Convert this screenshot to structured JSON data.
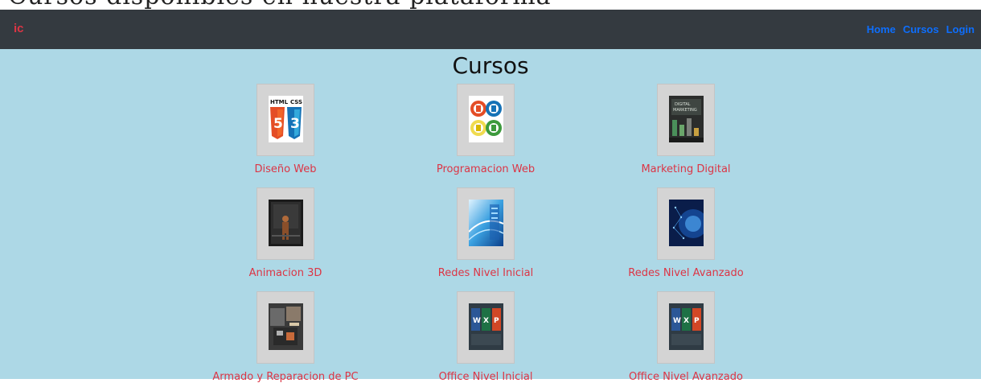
{
  "navbar": {
    "brand": "ic",
    "links": [
      {
        "label": "Home"
      },
      {
        "label": "Cursos"
      },
      {
        "label": "Login"
      }
    ]
  },
  "top_strip_text": "Cursos disponibles en nuestra plataforma",
  "main": {
    "title": "Cursos",
    "courses": [
      {
        "label": "Diseño Web",
        "icon": "html-css-logo-icon"
      },
      {
        "label": "Programacion Web",
        "icon": "web-technologies-icon"
      },
      {
        "label": "Marketing Digital",
        "icon": "digital-marketing-image"
      },
      {
        "label": "Animacion 3D",
        "icon": "3d-animation-image"
      },
      {
        "label": "Redes Nivel Inicial",
        "icon": "network-image"
      },
      {
        "label": "Redes Nivel Avanzado",
        "icon": "advanced-network-image"
      },
      {
        "label": "Armado y Reparacion de PC",
        "icon": "pc-repair-image"
      },
      {
        "label": "Office Nivel Inicial",
        "icon": "microsoft-office-icon"
      },
      {
        "label": "Office Nivel Avanzado",
        "icon": "microsoft-office-icon"
      }
    ]
  },
  "colors": {
    "navbar_bg": "#343a40",
    "brand": "#dc3545",
    "nav_link": "#0d6efd",
    "main_bg": "#add8e6",
    "course_label": "#dc3545"
  }
}
